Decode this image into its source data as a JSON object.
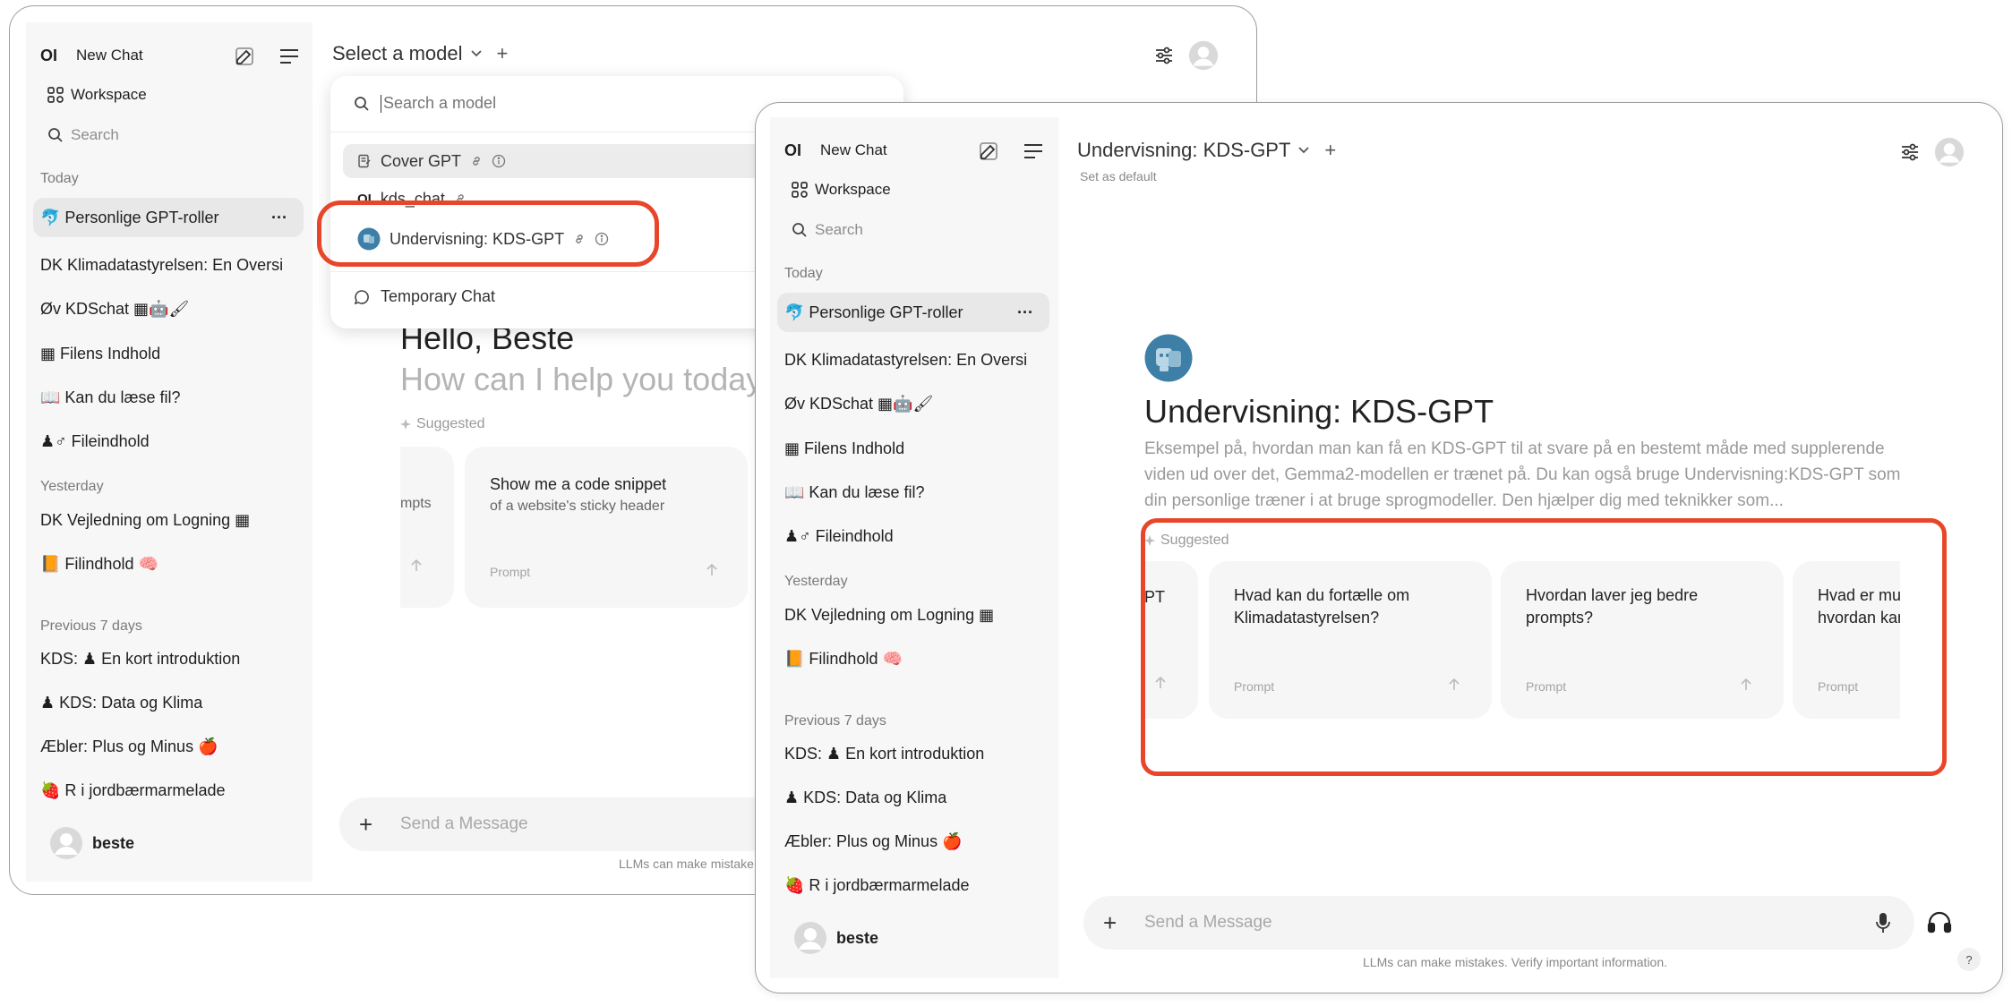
{
  "sidebar": {
    "logo": "OI",
    "new_chat": "New Chat",
    "workspace": "Workspace",
    "search": "Search",
    "today": "Today",
    "yesterday": "Yesterday",
    "previous_7_days": "Previous 7 days",
    "user_name": "beste",
    "today_items": [
      "🐬 Personlige GPT-roller",
      "DK Klimadatastyrelsen: En Oversi",
      "Øv KDSchat ▦🤖🖌",
      "▦ Filens Indhold",
      "📖 Kan du læse fil?",
      "♟♂ Fileindhold"
    ],
    "yesterday_items": [
      "DK Vejledning om Logning ▦",
      "📙 Filindhold 🧠"
    ],
    "previous_items": [
      "KDS: ♟ En kort introduktion",
      "♟ KDS: Data og Klima",
      "Æbler: Plus og Minus 🍎",
      "🍓 R i jordbærmarmelade"
    ],
    "more_dots": "···"
  },
  "window1": {
    "model_selector": "Select a model",
    "plus": "+",
    "dropdown": {
      "search_placeholder": "Search a model",
      "models": [
        {
          "name": "Cover GPT"
        },
        {
          "name": "kds_chat"
        },
        {
          "name": "Undervisning: KDS-GPT"
        }
      ],
      "temporary_chat": "Temporary Chat"
    },
    "greeting": "Hello, Beste",
    "subgreeting": "How can I help you today",
    "suggested": "Suggested",
    "cards": [
      {
        "title": "mpts",
        "subtitle": "",
        "label": ""
      },
      {
        "title": "Show me a code snippet",
        "subtitle": "of a website's sticky header",
        "label": "Prompt"
      }
    ],
    "send_placeholder": "Send a Message",
    "footer": "LLMs can make mistake"
  },
  "window2": {
    "model_title": "Undervisning: KDS-GPT",
    "plus": "+",
    "set_default": "Set as default",
    "model_name": "Undervisning: KDS-GPT",
    "description": "Eksempel på, hvordan man kan få en KDS-GPT til at svare på en bestemt måde med supplerende viden ud over det, Gemma2-modellen er trænet på. Du kan også bruge Undervisning:KDS-GPT som din personlige træner i at bruge sprogmodeller. Den hjælper dig med teknikker som...",
    "suggested": "Suggested",
    "cards": [
      {
        "title": "PT",
        "label": ""
      },
      {
        "title": "Hvad kan du fortælle om Klimadatastyrelsen?",
        "label": "Prompt"
      },
      {
        "title": "Hvordan laver jeg bedre prompts?",
        "label": "Prompt"
      },
      {
        "title": "Hvad er mul hvordan kan",
        "label": "Prompt"
      }
    ],
    "send_placeholder": "Send a Message",
    "footer": "LLMs can make mistakes. Verify important information.",
    "help": "?"
  },
  "colors": {
    "highlight": "#e8462a",
    "sidebar_bg": "#f7f7f7",
    "active_item": "#e8e8e8"
  }
}
